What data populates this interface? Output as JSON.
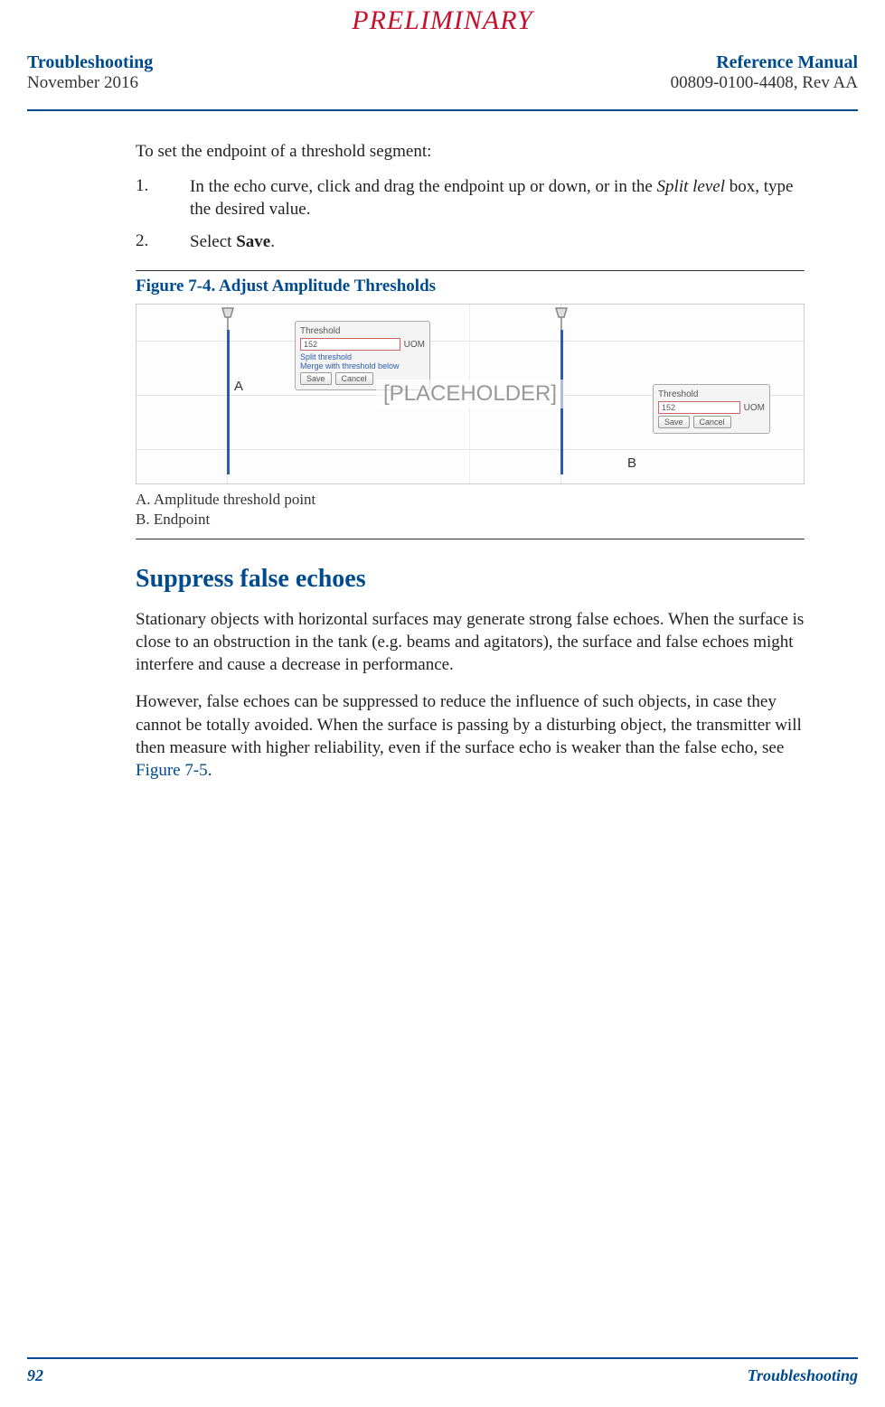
{
  "watermark": "PRELIMINARY",
  "header": {
    "left_title": "Troubleshooting",
    "left_sub": "November 2016",
    "right_title": "Reference Manual",
    "right_sub": "00809-0100-4408, Rev AA"
  },
  "content": {
    "intro": "To set the endpoint of a threshold segment:",
    "steps": [
      {
        "num": "1.",
        "text_prefix": "In the echo curve, click and drag the endpoint up or down, or in the ",
        "italic": "Split level",
        "text_suffix": " box, type the desired value."
      },
      {
        "num": "2.",
        "text_prefix": "Select ",
        "bold": "Save",
        "text_suffix": "."
      }
    ],
    "figure": {
      "caption": "Figure 7-4. Adjust Amplitude Thresholds",
      "placeholder": "[PLACEHOLDER]",
      "anno_a": "A",
      "anno_b": "B",
      "popup_left": {
        "label_threshold": "Threshold",
        "value": "152",
        "uom": "UOM",
        "split": "Split threshold",
        "merge": "Merge with threshold below",
        "save": "Save",
        "cancel": "Cancel"
      },
      "popup_right": {
        "label_threshold": "Threshold",
        "value": "152",
        "uom": "UOM",
        "save": "Save",
        "cancel": "Cancel"
      },
      "legend_a": "A. Amplitude threshold point",
      "legend_b": "B. Endpoint"
    },
    "section_heading": "Suppress false echoes",
    "para1": "Stationary objects with horizontal surfaces may generate strong false echoes. When the surface is close to an obstruction in the tank (e.g. beams and agitators), the surface and false echoes might interfere and cause a decrease in performance.",
    "para2_prefix": "However, false echoes can be suppressed to reduce the influence of such objects, in case they cannot be totally avoided. When the surface is passing by a disturbing object, the transmitter will then measure with higher reliability, even if the surface echo is weaker than the false echo, see ",
    "para2_link": "Figure 7-5",
    "para2_suffix": "."
  },
  "footer": {
    "page": "92",
    "section": "Troubleshooting"
  }
}
